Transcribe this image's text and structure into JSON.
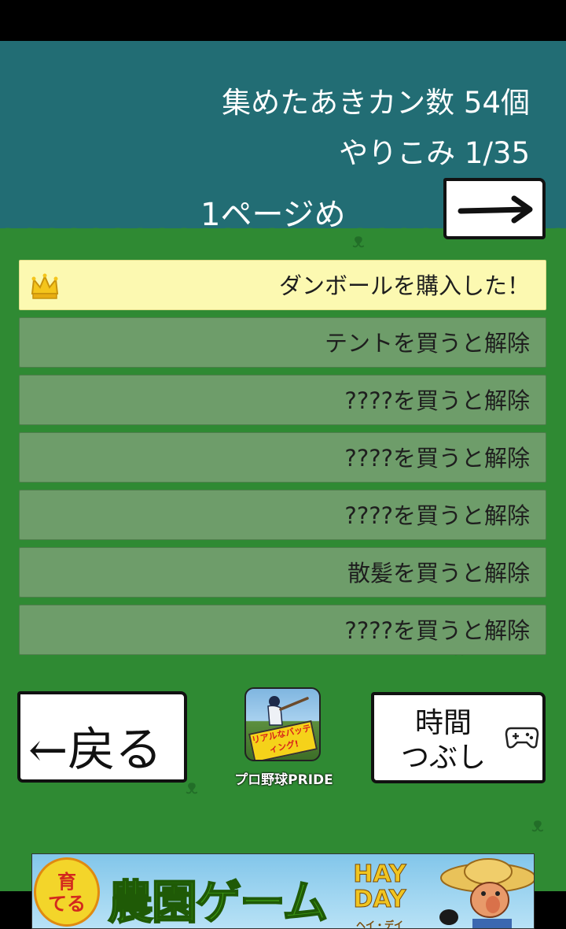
{
  "header": {
    "cans_collected": "集めたあきカン数 54個",
    "completion": "やりこみ 1/35",
    "page_label": "1ページめ"
  },
  "next_button": {
    "icon": "arrow-right-icon"
  },
  "achievements": [
    {
      "label": "ダンボールを購入した！",
      "unlocked": true,
      "icon": "crown-icon"
    },
    {
      "label": "テントを買うと解除",
      "unlocked": false
    },
    {
      "label": "????を買うと解除",
      "unlocked": false
    },
    {
      "label": "????を買うと解除",
      "unlocked": false
    },
    {
      "label": "????を買うと解除",
      "unlocked": false
    },
    {
      "label": "散髪を買うと解除",
      "unlocked": false
    },
    {
      "label": "????を買うと解除",
      "unlocked": false
    }
  ],
  "buttons": {
    "back": "←戻る",
    "kill_time_line1": "時間",
    "kill_time_line2": "つぶし",
    "kill_time_icon": "gamepad-icon"
  },
  "promo_app": {
    "badge_text": "リアルなバッティング!",
    "label": "プロ野球PRIDE"
  },
  "ad_banner": {
    "badge_line1": "育",
    "badge_line2": "てる",
    "title": "農園ゲーム",
    "logo": "HAY DAY",
    "logo_sub": "ヘイ・デイ"
  },
  "colors": {
    "sky": "#226d74",
    "grass": "#2f8a33",
    "locked_row": "#6e9d6a",
    "unlocked_row": "#fcf9b1"
  }
}
